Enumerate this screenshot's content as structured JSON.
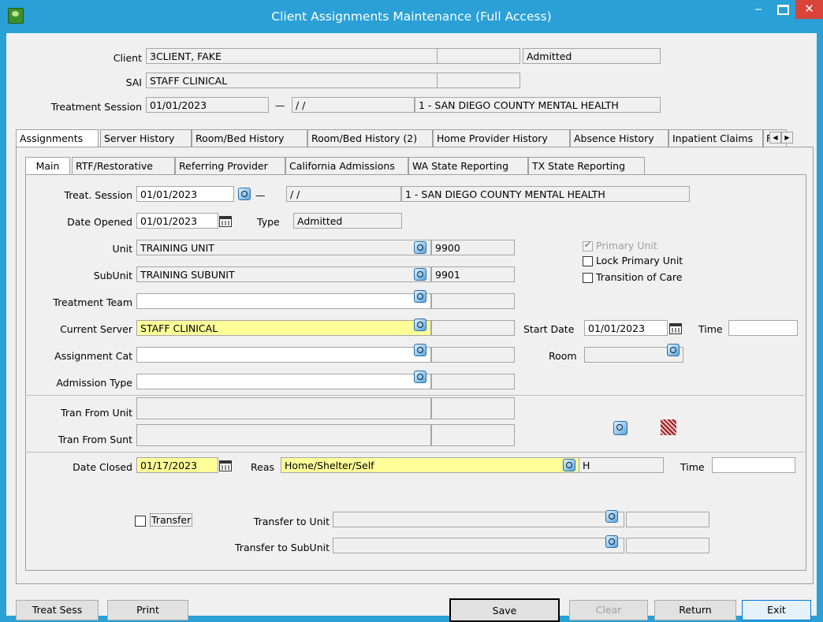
{
  "window": {
    "title": "Client Assignments Maintenance (Full Access)",
    "minimize": "‒",
    "close": "✕"
  },
  "header": {
    "client_label": "Client",
    "client_value": "3CLIENT, FAKE",
    "client_status": "Admitted",
    "sai_label": "SAI",
    "sai_value": "STAFF CLINICAL",
    "ts_label": "Treatment Session",
    "ts_start": "01/01/2023",
    "ts_dash": "—",
    "ts_end": "/ /",
    "ts_org": "1 - SAN DIEGO COUNTY MENTAL HEALTH"
  },
  "outer_tabs": [
    "Assignments",
    "Server History",
    "Room/Bed History",
    "Room/Bed History (2)",
    "Home Provider History",
    "Absence History",
    "Inpatient Claims",
    "Fam"
  ],
  "inner_tabs": [
    "Main",
    "RTF/Restorative",
    "Referring Provider",
    "California Admissions",
    "WA State Reporting",
    "TX State Reporting"
  ],
  "main": {
    "treat_session_label": "Treat. Session",
    "treat_session_start": "01/01/2023",
    "treat_session_dash": "—",
    "treat_session_end": "/ /",
    "treat_session_org": "1 - SAN DIEGO COUNTY MENTAL HEALTH",
    "date_opened_label": "Date Opened",
    "date_opened": "01/01/2023",
    "type_label": "Type",
    "type_value": "Admitted",
    "unit_label": "Unit",
    "unit_value": "TRAINING UNIT",
    "unit_code": "9900",
    "subunit_label": "SubUnit",
    "subunit_value": "TRAINING SUBUNIT",
    "subunit_code": "9901",
    "team_label": "Treatment Team",
    "team_value": "",
    "team_code": "",
    "server_label": "Current Server",
    "server_value": "STAFF CLINICAL",
    "server_code": "",
    "assign_cat_label": "Assignment Cat",
    "assign_cat_value": "",
    "assign_cat_code": "",
    "adm_type_label": "Admission Type",
    "adm_type_value": "",
    "adm_type_code": "",
    "primary_unit": "Primary Unit",
    "lock_primary_unit": "Lock Primary Unit",
    "transition_of_care": "Transition of Care",
    "start_date_label": "Start Date",
    "start_date": "01/01/2023",
    "time_label": "Time",
    "time_value": "",
    "room_label": "Room",
    "room_value": "",
    "tran_from_unit_label": "Tran From Unit",
    "tran_from_sunt_label": "Tran From Sunt",
    "date_closed_label": "Date Closed",
    "date_closed": "01/17/2023",
    "reas_label": "Reas",
    "reas_value": "Home/Shelter/Self",
    "reas_code": "H",
    "closed_time_label": "Time",
    "closed_time_value": "",
    "transfer_label": "Transfer",
    "transfer_unit_label": "Transfer to Unit",
    "transfer_subunit_label": "Transfer to SubUnit"
  },
  "buttons": {
    "treat_sess": "Treat Sess",
    "print": "Print",
    "save": "Save",
    "clear": "Clear",
    "return": "Return",
    "exit": "Exit"
  },
  "colors": {
    "titlebar": "#2aa0d6",
    "required_field": "#ffff99",
    "close_button": "#d9433a"
  },
  "icons": [
    "app-icon",
    "lookup-icon",
    "calendar-icon",
    "delete-icon",
    "scroll-left-icon",
    "scroll-right-icon"
  ]
}
